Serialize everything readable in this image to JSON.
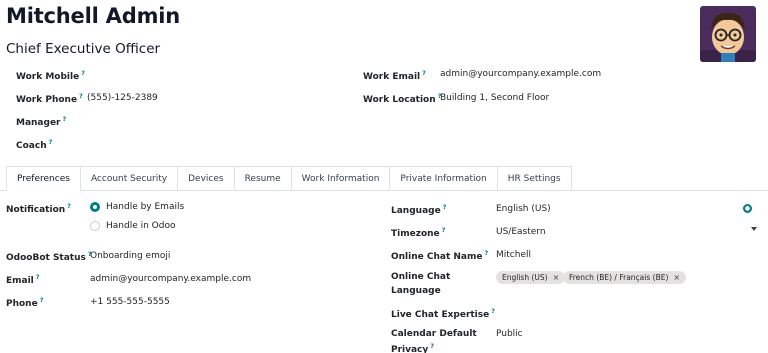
{
  "employee": {
    "name": "Mitchell Admin",
    "job_title": "Chief Executive Officer"
  },
  "fields": {
    "work_mobile_label": "Work Mobile",
    "work_phone_label": "Work Phone",
    "work_phone_value": "(555)-125-2389",
    "manager_label": "Manager",
    "coach_label": "Coach",
    "work_email_label": "Work Email",
    "work_email_value": "admin@yourcompany.example.com",
    "work_location_label": "Work Location",
    "work_location_value": "Building 1, Second Floor",
    "help_mark": "?"
  },
  "tabs": [
    {
      "label": "Preferences"
    },
    {
      "label": "Account Security"
    },
    {
      "label": "Devices"
    },
    {
      "label": "Resume"
    },
    {
      "label": "Work Information"
    },
    {
      "label": "Private Information"
    },
    {
      "label": "HR Settings"
    }
  ],
  "preferences": {
    "notification_label": "Notification",
    "notification_options": [
      "Handle by Emails",
      "Handle in Odoo"
    ],
    "notification_selected": "Handle by Emails",
    "odoobot_label": "OdooBot Status",
    "odoobot_value": "Onboarding emoji",
    "email_label": "Email",
    "email_value": "admin@yourcompany.example.com",
    "phone_label": "Phone",
    "phone_value": "+1 555-555-5555",
    "language_label": "Language",
    "language_value": "English (US)",
    "timezone_label": "Timezone",
    "timezone_value": "US/Eastern",
    "chat_name_label": "Online Chat Name",
    "chat_name_value": "Mitchell",
    "chat_language_label_1": "Online Chat",
    "chat_language_label_2": "Language",
    "chat_language_tags": [
      "English (US)",
      "French (BE) / Français (BE)"
    ],
    "tag_remove": "×",
    "expertise_label": "Live Chat Expertise",
    "calendar_label_1": "Calendar Default",
    "calendar_label_2": "Privacy",
    "calendar_value": "Public"
  },
  "colors": {
    "accent": "#017e84",
    "tag_bg": "#e5e1e1",
    "border": "#dee2e6"
  }
}
